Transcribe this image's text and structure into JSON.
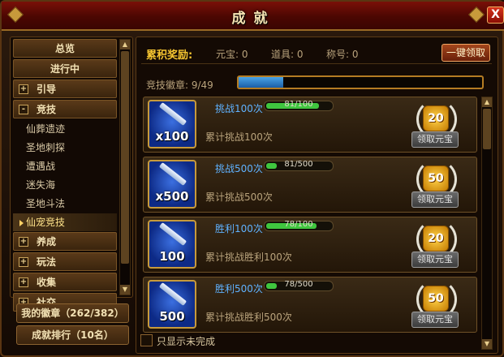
{
  "window": {
    "title": "成就",
    "close_label": "X"
  },
  "nav": {
    "items": [
      {
        "label": "总览",
        "type": "main",
        "box": ""
      },
      {
        "label": "进行中",
        "type": "main",
        "box": ""
      },
      {
        "label": "引导",
        "type": "main",
        "box": "+"
      },
      {
        "label": "竞技",
        "type": "main",
        "box": "-"
      },
      {
        "label": "仙葬遗迹",
        "type": "sub"
      },
      {
        "label": "圣地刺探",
        "type": "sub"
      },
      {
        "label": "遭遇战",
        "type": "sub"
      },
      {
        "label": "迷失海",
        "type": "sub"
      },
      {
        "label": "圣地斗法",
        "type": "sub"
      },
      {
        "label": "仙宠竞技",
        "type": "sub",
        "active": true
      },
      {
        "label": "养成",
        "type": "main",
        "box": "+"
      },
      {
        "label": "玩法",
        "type": "main",
        "box": "+"
      },
      {
        "label": "收集",
        "type": "main",
        "box": "+"
      },
      {
        "label": "社交",
        "type": "main",
        "box": "+"
      }
    ],
    "my_badges": "我的徽章（262/382）",
    "ranking": "成就排行（10名）"
  },
  "rewards": {
    "label": "累积奖励:",
    "yuanbao": "元宝: 0",
    "items": "道具: 0",
    "titles": "称号: 0",
    "claim_all": "一键领取"
  },
  "progress": {
    "label": "竞技徽章: 9/49",
    "fraction": 0.184
  },
  "achievements": [
    {
      "name": "挑战100次",
      "progress_text": "81/100",
      "progress": 0.81,
      "desc": "累计挑战100次",
      "badge": "x100",
      "reward": "20",
      "claim": "领取元宝"
    },
    {
      "name": "挑战500次",
      "progress_text": "81/500",
      "progress": 0.16,
      "desc": "累计挑战500次",
      "badge": "x500",
      "reward": "50",
      "claim": "领取元宝"
    },
    {
      "name": "胜利100次",
      "progress_text": "78/100",
      "progress": 0.78,
      "desc": "累计挑战胜利100次",
      "badge": "100",
      "reward": "20",
      "claim": "领取元宝"
    },
    {
      "name": "胜利500次",
      "progress_text": "78/500",
      "progress": 0.16,
      "desc": "累计挑战胜利500次",
      "badge": "500",
      "reward": "50",
      "claim": "领取元宝"
    }
  ],
  "filter": {
    "label": "只显示未完成",
    "checked": false
  },
  "colors": {
    "accent_gold": "#f5c531",
    "link_blue": "#5fb2ff",
    "progress_green": "#3fc63f",
    "title_red": "#7a1008"
  }
}
